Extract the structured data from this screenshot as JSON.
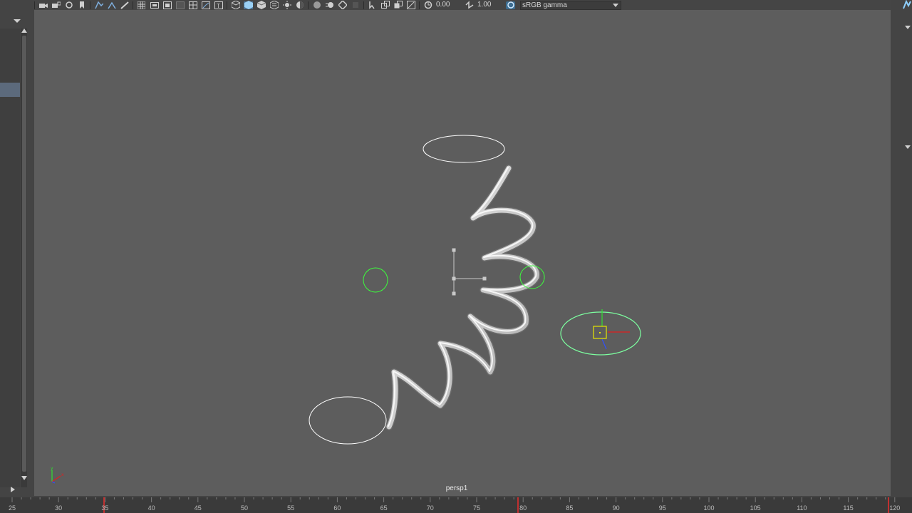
{
  "toolbar": {
    "exposure_value": "0.00",
    "gamma_value": "1.00",
    "color_space_option": "sRGB gamma",
    "icons": [
      "camera-icon",
      "camera-lock-icon",
      "camera-attributes-icon",
      "bookmark-icon",
      "image-plane-icon",
      "two-d-pan-icon",
      "grease-pencil-icon",
      "grid-icon",
      "film-gate-icon",
      "resolution-gate-icon",
      "gate-mask-icon",
      "field-chart-icon",
      "safe-action-icon",
      "safe-title-icon",
      "wireframe-icon",
      "smooth-shade-icon",
      "wireframe-on-shaded-icon",
      "textured-icon",
      "use-all-lights-icon",
      "shadows-icon",
      "screen-space-ao-icon",
      "motion-blur-icon",
      "anti-aliasing-icon",
      "depth-of-field-icon",
      "isolate-select-icon",
      "xray-icon",
      "xray-joints-icon",
      "xray-components-icon",
      "exposure-icon",
      "gamma-icon",
      "color-management-icon"
    ]
  },
  "viewport": {
    "camera_label": "persp1",
    "colors": {
      "background": "#5d5d5d",
      "curve_white": "#ffffff",
      "control_green": "#3cff3c",
      "selected_green": "#7dffa0",
      "pivot_yellow": "#e6e600",
      "axis_red": "#e02020",
      "axis_green": "#30e030",
      "axis_blue": "#3050ff"
    }
  },
  "timeline": {
    "ticks": [
      "25",
      "30",
      "35",
      "40",
      "45",
      "50",
      "55",
      "60",
      "65",
      "70",
      "75",
      "80",
      "85",
      "90",
      "95",
      "100",
      "105",
      "110",
      "115",
      "120"
    ],
    "key_marker_color": "#c03030"
  }
}
